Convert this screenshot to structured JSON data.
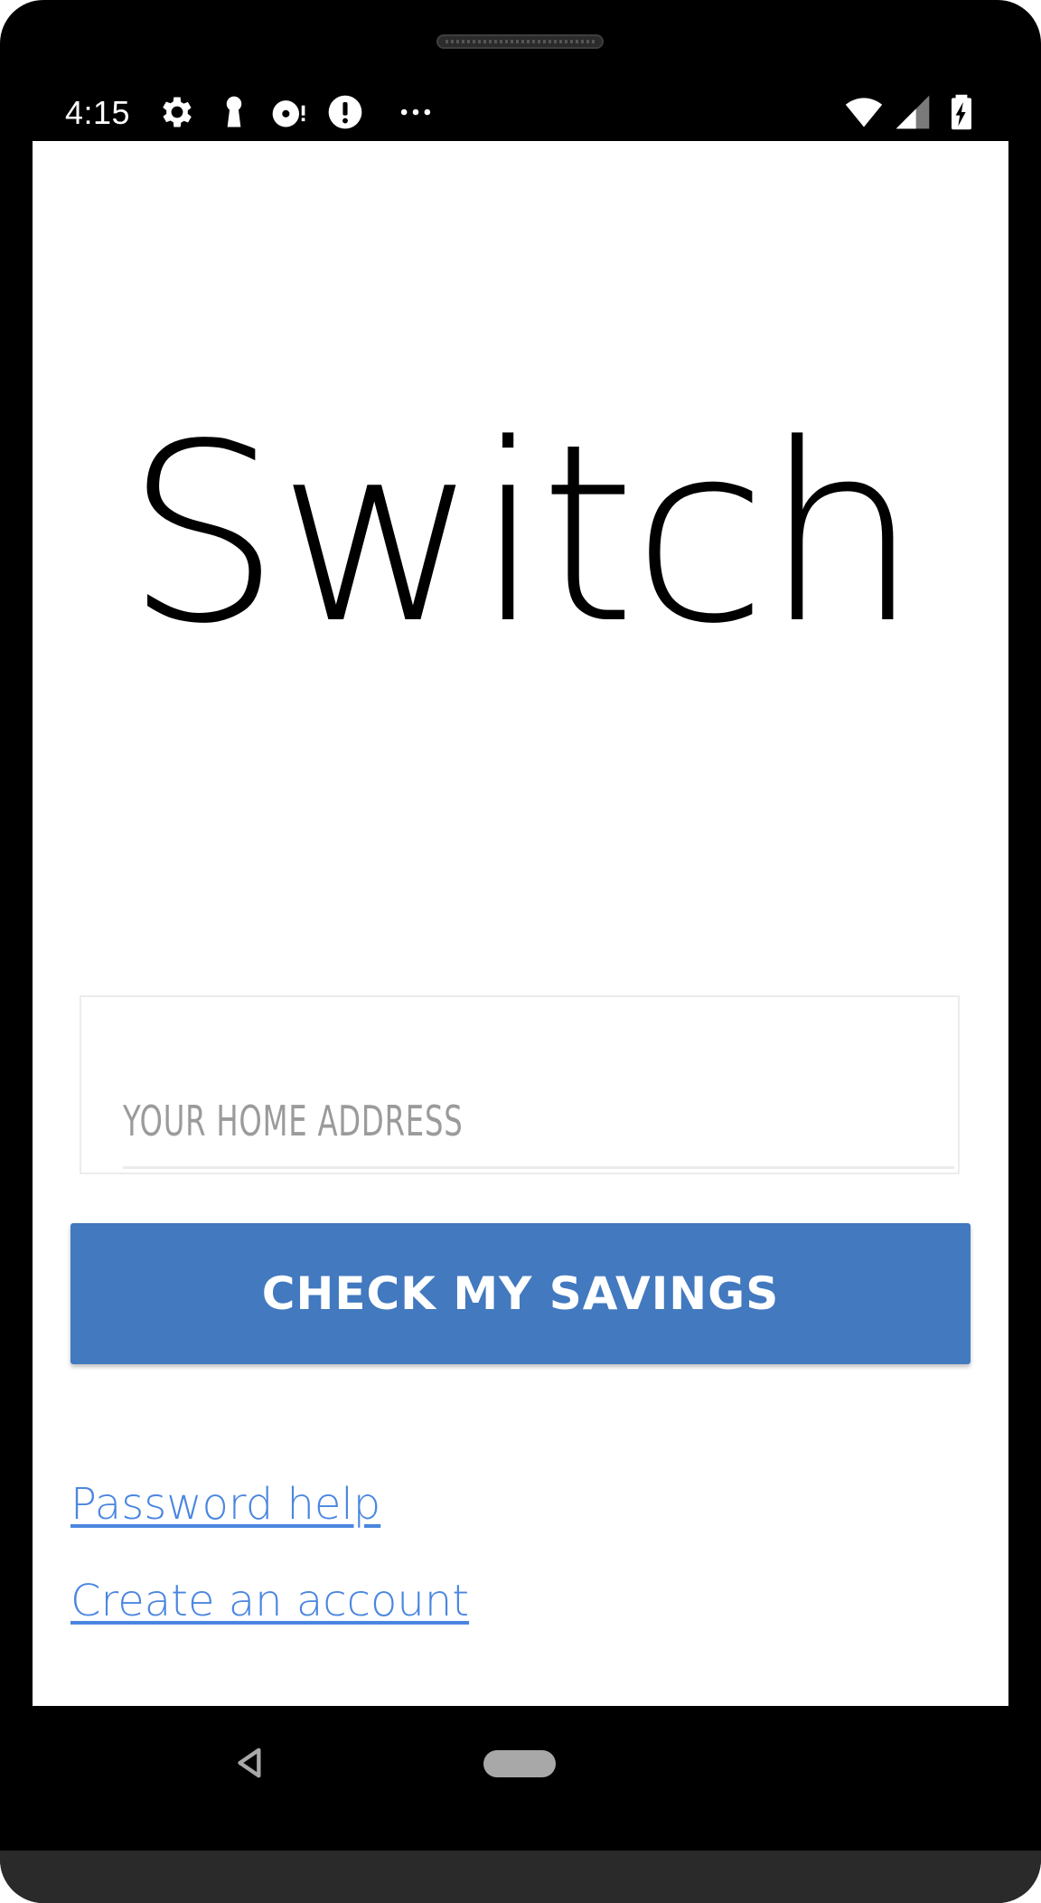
{
  "status_bar": {
    "time": "4:15",
    "icons": [
      "gear-icon",
      "keyhole-icon",
      "disk-alert-icon",
      "alert-circle-icon",
      "more-dots-icon",
      "wifi-icon",
      "signal-icon",
      "battery-charging-icon"
    ]
  },
  "app": {
    "title": "Switch"
  },
  "address": {
    "placeholder": "YOUR HOME ADDRESS",
    "value": ""
  },
  "actions": {
    "check_savings_label": "CHECK MY SAVINGS"
  },
  "links": {
    "password_help": "Password help",
    "create_account": "Create an account"
  },
  "navigation": {
    "icons": [
      "back-icon",
      "home-icon"
    ]
  },
  "colors": {
    "accent": "#4279bf",
    "link": "#4a86e0",
    "placeholder": "#9b9b9b"
  }
}
